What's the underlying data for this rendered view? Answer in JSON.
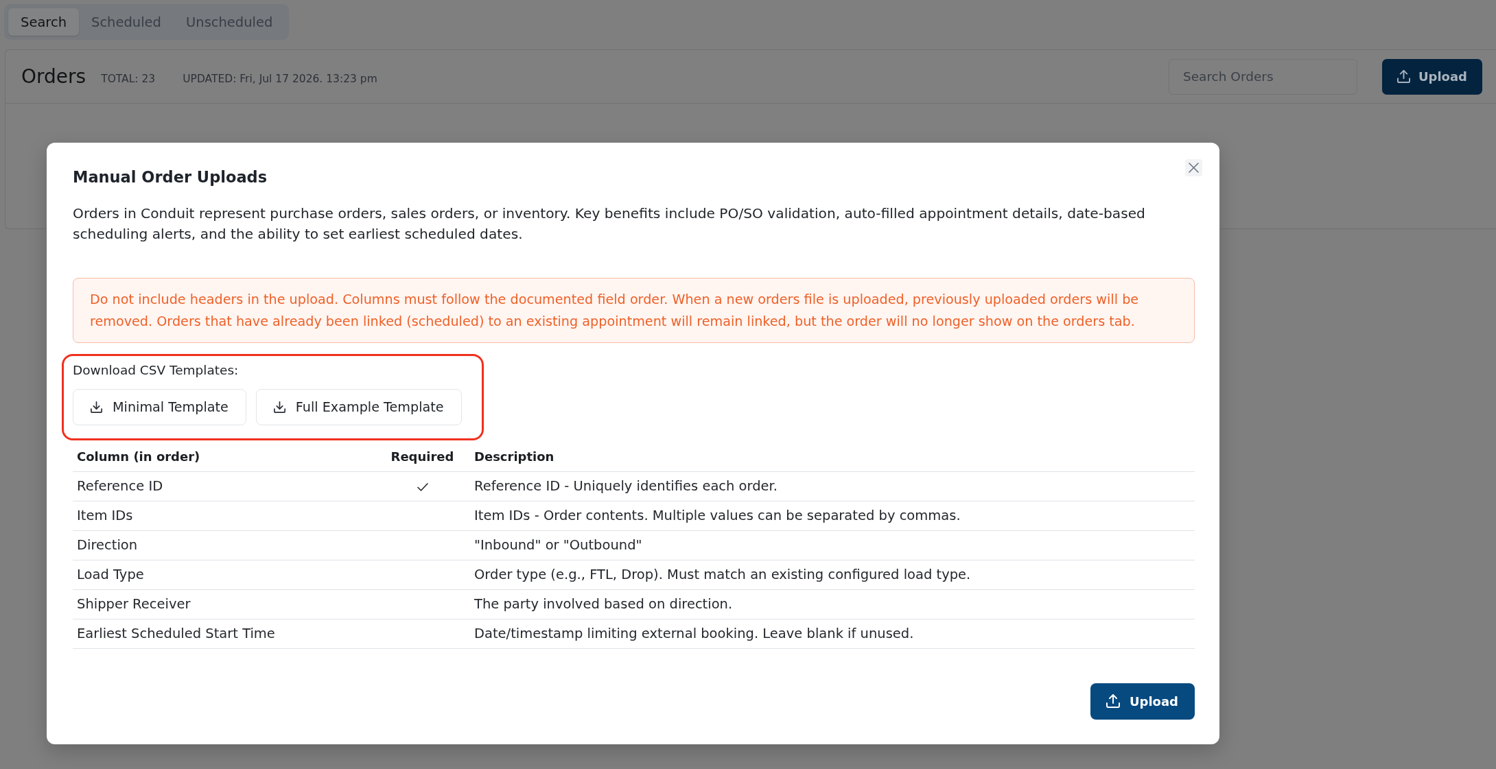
{
  "tabs": [
    {
      "label": "Search",
      "selected": true
    },
    {
      "label": "Scheduled",
      "selected": false
    },
    {
      "label": "Unscheduled",
      "selected": false
    }
  ],
  "orders_panel": {
    "title": "Orders",
    "total": "TOTAL: 23",
    "updated": "UPDATED: Fri, Jul 17 2026. 13:23 pm",
    "search": {
      "placeholder": "Search Orders"
    },
    "upload_button": "Upload"
  },
  "modal": {
    "title": "Manual Order Uploads",
    "description": "Orders in Conduit represent purchase orders, sales orders, or inventory. Key benefits include PO/SO validation, auto-filled appointment details, date-based scheduling alerts, and the ability to set earliest scheduled dates.",
    "warning": "Do not include headers in the upload. Columns must follow the documented field order. When a new orders file is uploaded, previously uploaded orders will be removed. Orders that have already been linked (scheduled) to an existing appointment will remain linked, but the order will no longer show on the orders tab.",
    "templates": {
      "highlighted": true,
      "label": "Download CSV Templates:",
      "buttons": [
        "Minimal Template",
        "Full Example Template"
      ]
    },
    "table": {
      "columns": [
        "Column (in order)",
        "Required",
        "Description"
      ],
      "rows": [
        {
          "column": "Reference ID",
          "required": true,
          "description": "Reference ID - Uniquely identifies each order."
        },
        {
          "column": "Item IDs",
          "required": false,
          "description": "Item IDs - Order contents. Multiple values can be separated by commas."
        },
        {
          "column": "Direction",
          "required": false,
          "description": "\"Inbound\" or \"Outbound\""
        },
        {
          "column": "Load Type",
          "required": false,
          "description": "Order type (e.g., FTL, Drop). Must match an existing configured load type."
        },
        {
          "column": "Shipper Receiver",
          "required": false,
          "description": "The party involved based on direction."
        },
        {
          "column": "Earliest Scheduled Start Time",
          "required": false,
          "description": "Date/timestamp limiting external booking. Leave blank if unused."
        }
      ]
    },
    "upload_button": "Upload"
  }
}
